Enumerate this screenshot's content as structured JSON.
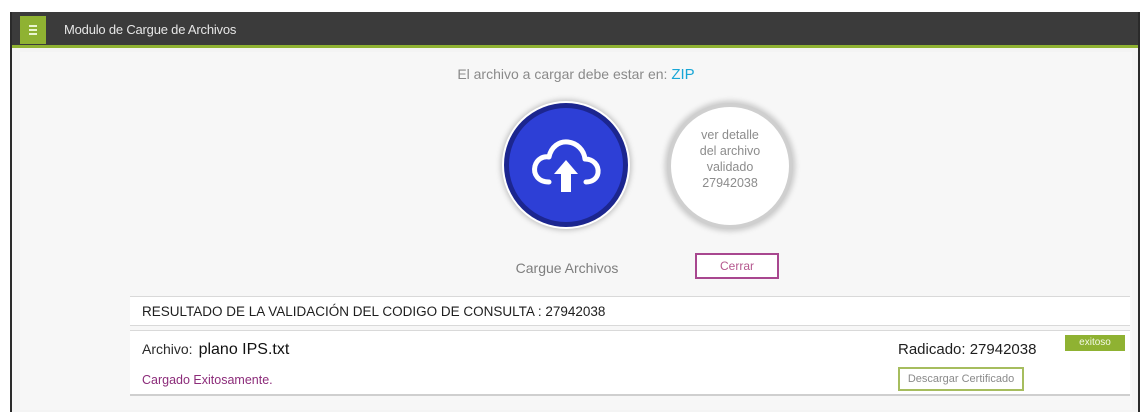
{
  "header": {
    "title": "Modulo de Cargue de Archivos",
    "menu_icon": "hamburger-icon"
  },
  "upload": {
    "instruction_prefix": "El archivo a cargar debe estar en:",
    "format": "ZIP",
    "upload_icon": "cloud-upload-icon",
    "upload_label": "Cargue Archivos"
  },
  "detail": {
    "lines": [
      "ver detalle",
      "del archivo",
      "validado",
      "27942038"
    ]
  },
  "close_button": "Cerrar",
  "result": {
    "title": "RESULTADO DE LA VALIDACIÓN DEL CODIGO DE CONSULTA : 27942038"
  },
  "file": {
    "label": "Archivo:",
    "name": "plano IPS.txt",
    "status_text": "Cargado Exitosamente.",
    "radicado": "Radicado: 27942038",
    "badge": "exitoso",
    "certificate_button": "Descargar Certificado"
  },
  "colors": {
    "accent_green": "#8fb232",
    "upload_blue": "#2d3fd6",
    "zip_blue": "#18a6d6",
    "status_purple": "#8c2c7a"
  }
}
